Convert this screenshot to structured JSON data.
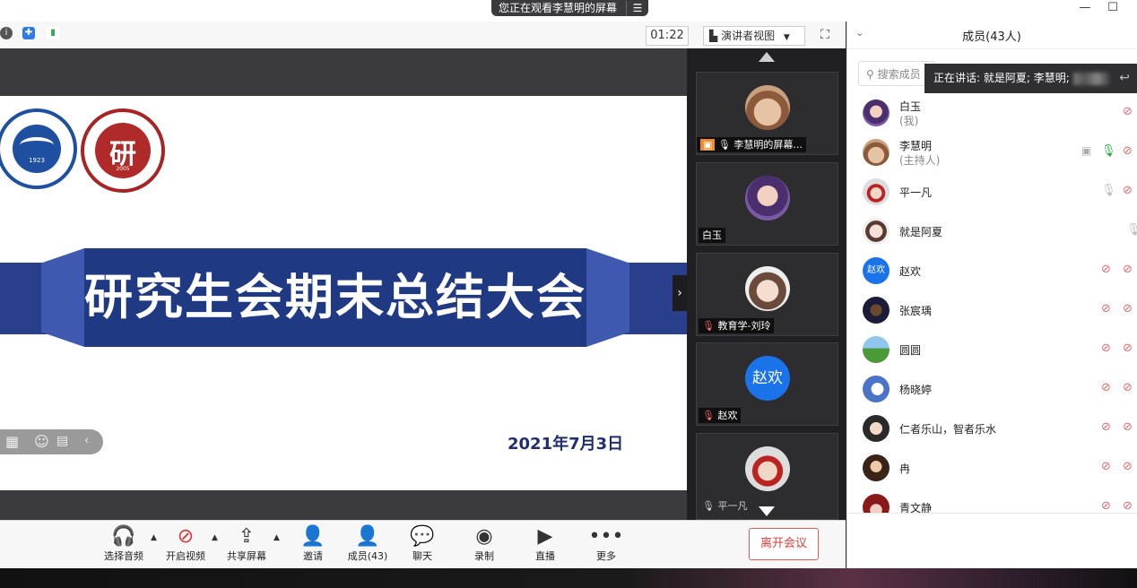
{
  "banner": {
    "text": "您正在观看李慧明的屏幕",
    "menu_icon": "list-icon"
  },
  "meeting": {
    "timer": "01:22",
    "view_label": "演讲者视图"
  },
  "slide": {
    "title": "研究生会期末总结大会",
    "date": "2021年7月3日",
    "logo1_year": "1923",
    "logo2_char": "研",
    "logo2_year": "2005"
  },
  "videos": [
    {
      "name": "李慧明的屏幕..."
    },
    {
      "name": "白玉"
    },
    {
      "name": "教育学-刘玲"
    },
    {
      "name": "赵欢",
      "avatar_text": "赵欢"
    },
    {
      "name": "平一凡"
    }
  ],
  "toolbar": {
    "audio": "选择音频",
    "video": "开启视频",
    "share": "共享屏幕",
    "invite": "邀请",
    "members": "成员(43)",
    "chat": "聊天",
    "record": "录制",
    "live": "直播",
    "more": "更多",
    "leave": "离开会议"
  },
  "panel": {
    "title": "成员(43人)",
    "search_placeholder": "搜索成员",
    "speaking": "正在讲话: 就是阿夏; 李慧明;"
  },
  "members": [
    {
      "name": "白玉",
      "sub": "(我)"
    },
    {
      "name": "李慧明",
      "sub": "(主持人)"
    },
    {
      "name": "平一凡"
    },
    {
      "name": "就是阿夏"
    },
    {
      "name": "赵欢",
      "avatar_text": "赵欢"
    },
    {
      "name": "张宸瑀"
    },
    {
      "name": "圆圆"
    },
    {
      "name": "杨晓婷"
    },
    {
      "name": "仁者乐山，智者乐水"
    },
    {
      "name": "冉"
    },
    {
      "name": "青文静"
    }
  ],
  "colors": {
    "accent_blue": "#1a73e8",
    "slide_navy": "#1f3a83",
    "leave_red": "#e03c3c"
  }
}
